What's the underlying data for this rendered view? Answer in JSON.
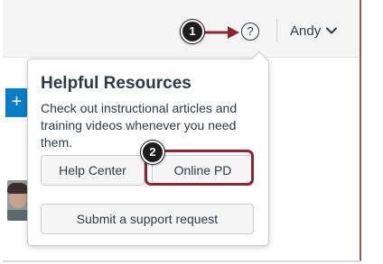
{
  "header": {
    "help_icon_glyph": "?",
    "user_name": "Andy"
  },
  "callouts": {
    "step_1": "1",
    "step_2": "2",
    "arrow_color": "#8e2530",
    "highlight_color": "#8e2530"
  },
  "sidebar": {
    "add_glyph": "+"
  },
  "popover": {
    "title": "Helpful Resources",
    "description": "Check out instructional articles and training videos whenever you need them.",
    "buttons": {
      "help_center": "Help Center",
      "online_pd": "Online PD",
      "support_request": "Submit a support request"
    }
  },
  "colors": {
    "accent_blue": "#0a7dc7",
    "text": "#2d3b45",
    "badge": "#1d1d1d"
  }
}
